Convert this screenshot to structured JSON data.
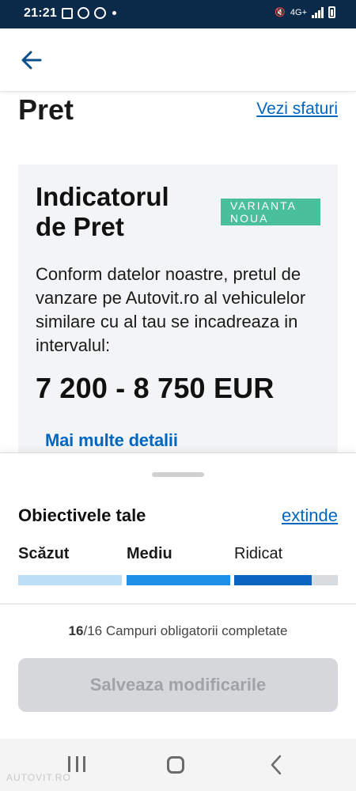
{
  "status_bar": {
    "time": "21:21",
    "network": "4G+"
  },
  "app_bar": {
    "back_icon": "arrow-left-icon"
  },
  "header": {
    "title": "Pret",
    "tips_link": "Vezi sfaturi"
  },
  "price_indicator": {
    "title": "Indicatorul de Pret",
    "badge": "VARIANTA NOUA",
    "description": "Conform datelor noastre, pretul de vanzare pe Autovit.ro al vehiculelor similare cu al tau se incadreaza in intervalul:",
    "price_range": "7 200 - 8 750 EUR",
    "details_link": "Mai multe detalii"
  },
  "goals": {
    "title": "Obiectivele tale",
    "expand_link": "extinde",
    "levels": [
      "Scăzut",
      "Mediu",
      "Ridicat"
    ],
    "active_level_fill": 0.75
  },
  "form": {
    "fields_completed": "16",
    "fields_status_rest": "/16 Campuri obligatorii completate",
    "save_label": "Salveaza modificarile"
  },
  "watermark": "AUTOVIT.RO",
  "colors": {
    "brand_dark": "#0b2a4a",
    "link_blue": "#0066c0",
    "badge_green": "#49bf9b",
    "bar_low": "#bcdff7",
    "bar_mid": "#1e90e8",
    "bar_high": "#0a64c0"
  }
}
